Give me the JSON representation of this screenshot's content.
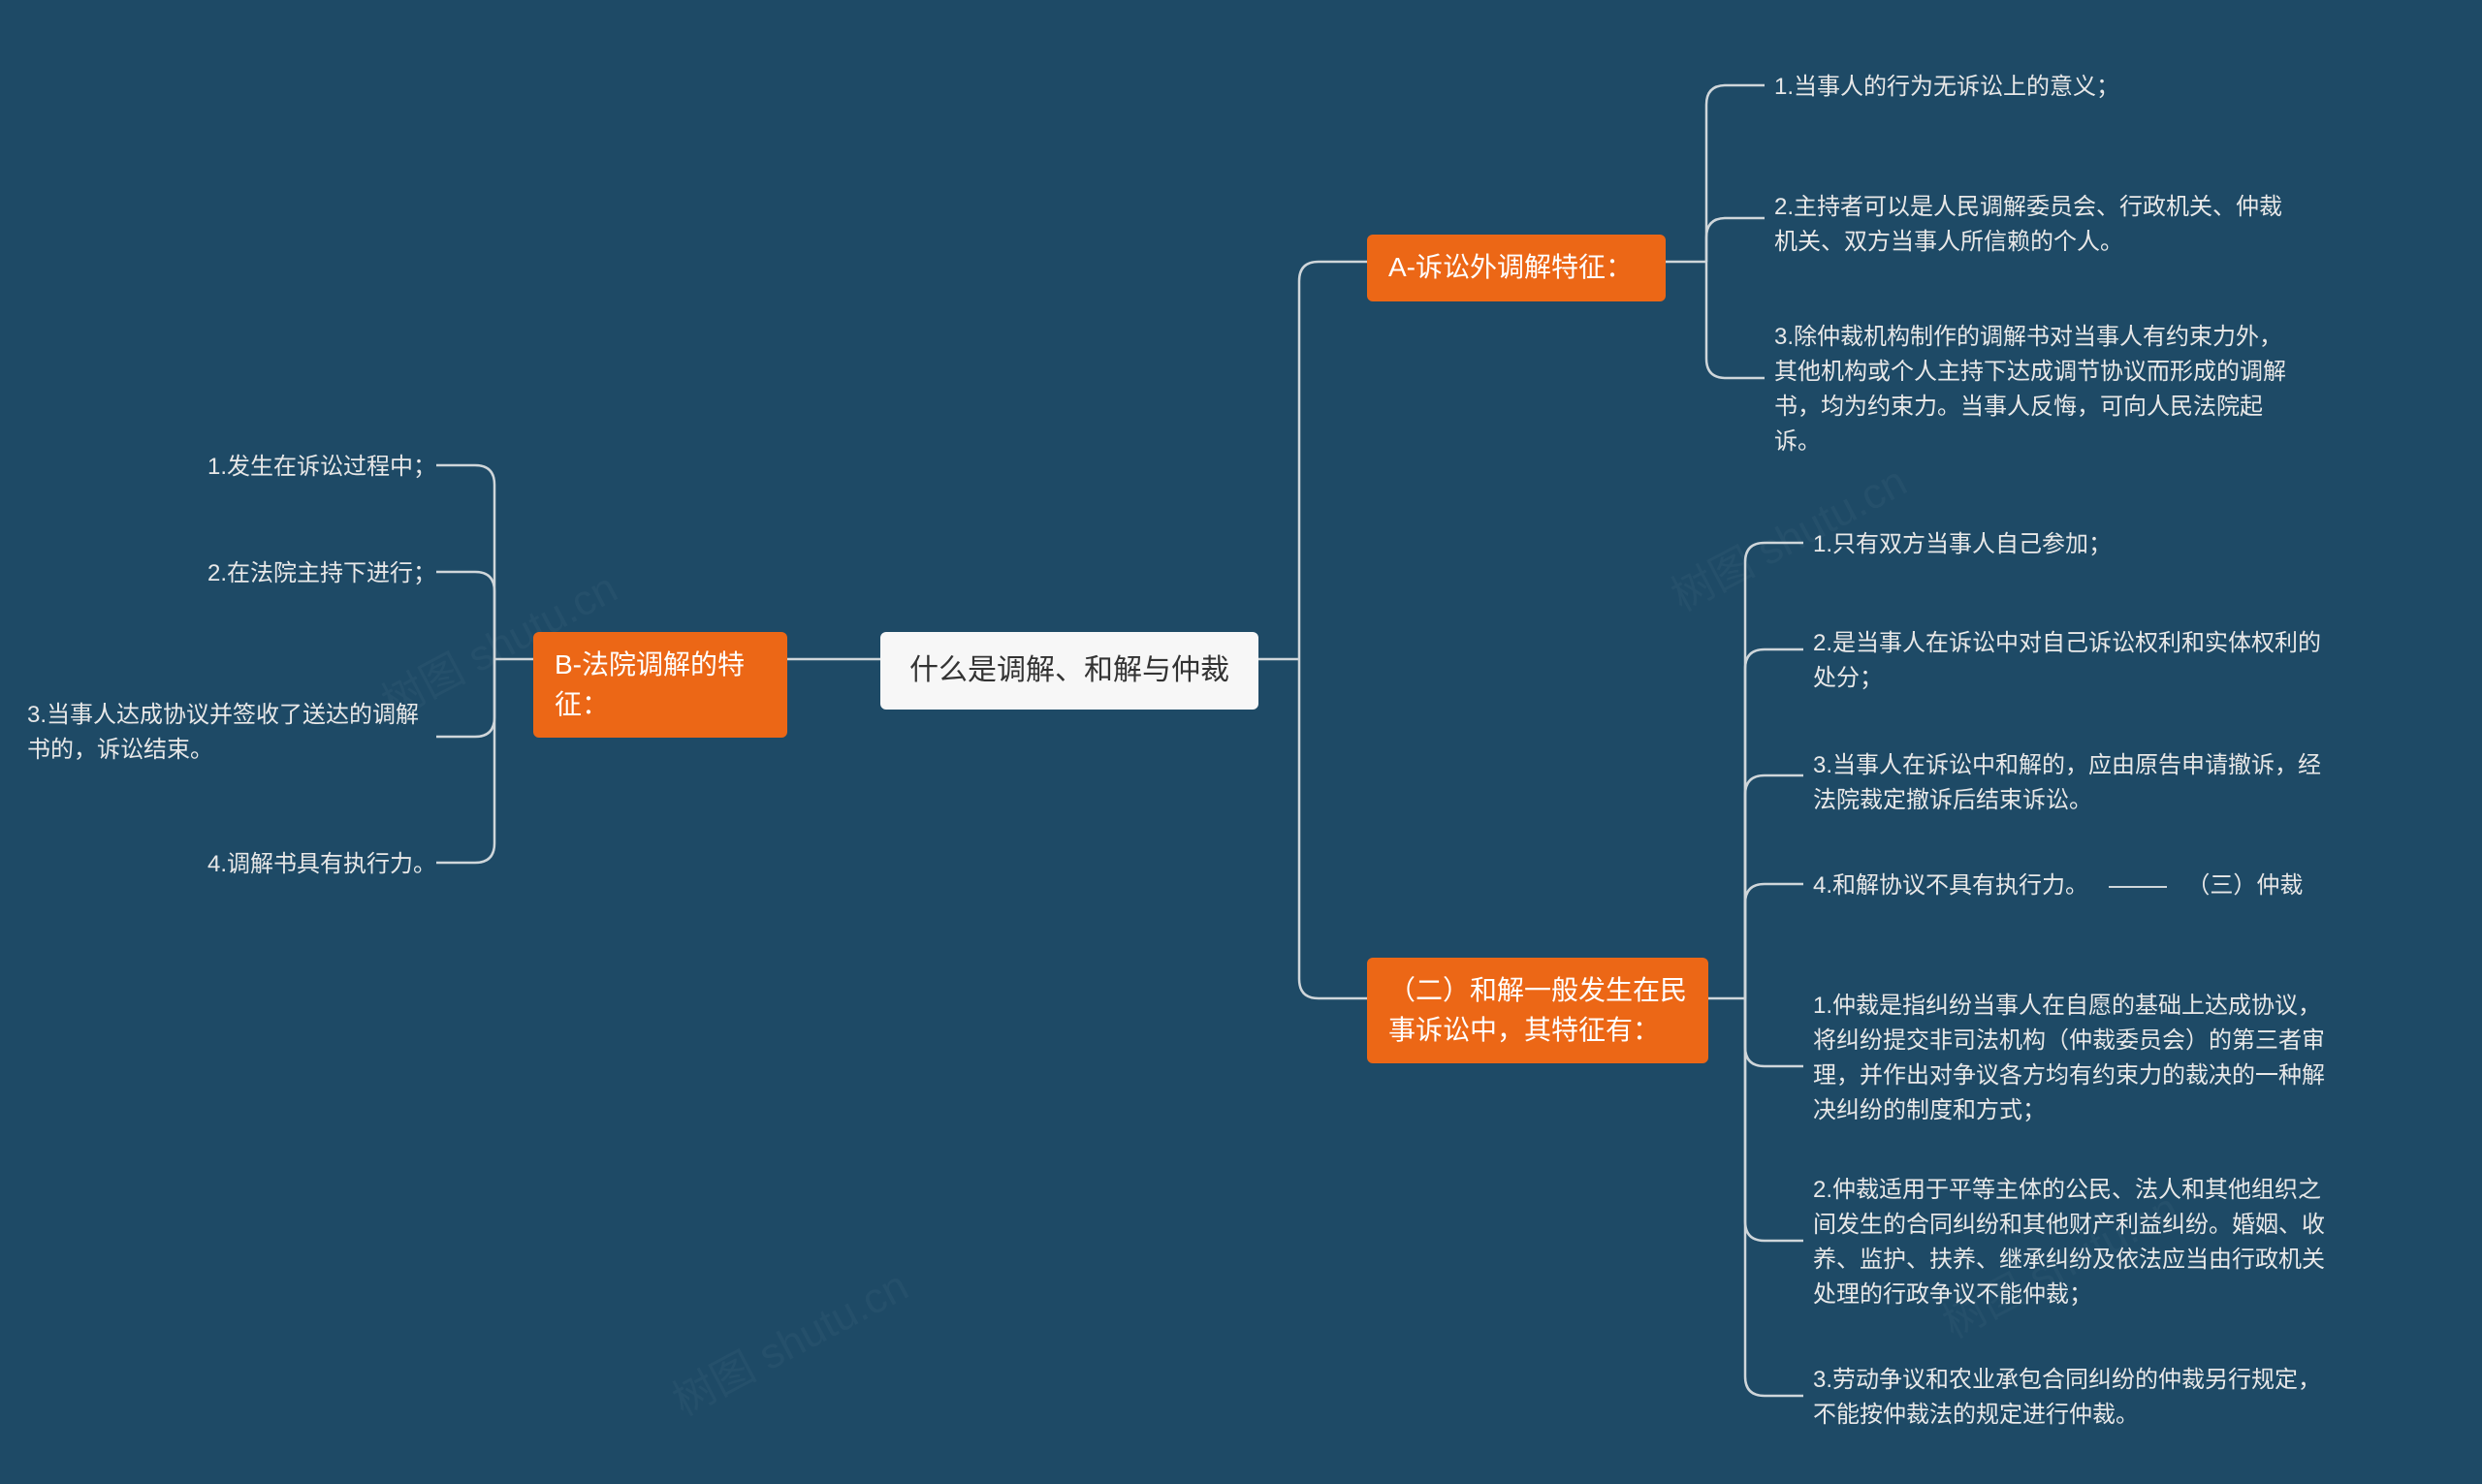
{
  "watermark_text": "树图 shutu.cn",
  "root": {
    "label": "什么是调解、和解与仲裁"
  },
  "branch_a": {
    "label": "A-诉讼外调解特征：",
    "items": [
      "1.当事人的行为无诉讼上的意义；",
      "2.主持者可以是人民调解委员会、行政机关、仲裁机关、双方当事人所信赖的个人。",
      "3.除仲裁机构制作的调解书对当事人有约束力外，其他机构或个人主持下达成调节协议而形成的调解书，均为约束力。当事人反悔，可向人民法院起诉。"
    ]
  },
  "branch_b": {
    "label": "B-法院调解的特征：",
    "items": [
      "1.发生在诉讼过程中；",
      "2.在法院主持下进行；",
      "3.当事人达成协议并签收了送达的调解书的，诉讼结束。",
      "4.调解书具有执行力。"
    ]
  },
  "branch_c": {
    "label": "（二）和解一般发生在民事诉讼中，其特征有：",
    "items": [
      "1.只有双方当事人自己参加；",
      "2.是当事人在诉讼中对自己诉讼权利和实体权利的处分；",
      "3.当事人在诉讼中和解的，应由原告申请撤诉，经法院裁定撤诉后结束诉讼。",
      "4.和解协议不具有执行力。",
      "（三）仲裁",
      "1.仲裁是指纠纷当事人在自愿的基础上达成协议，将纠纷提交非司法机构（仲裁委员会）的第三者审理，并作出对争议各方均有约束力的裁决的一种解决纠纷的制度和方式；",
      "2.仲裁适用于平等主体的公民、法人和其他组织之间发生的合同纠纷和其他财产利益纠纷。婚姻、收养、监护、扶养、继承纠纷及依法应当由行政机关处理的行政争议不能仲裁；",
      "3.劳动争议和农业承包合同纠纷的仲裁另行规定，不能按仲裁法的规定进行仲裁。"
    ]
  }
}
